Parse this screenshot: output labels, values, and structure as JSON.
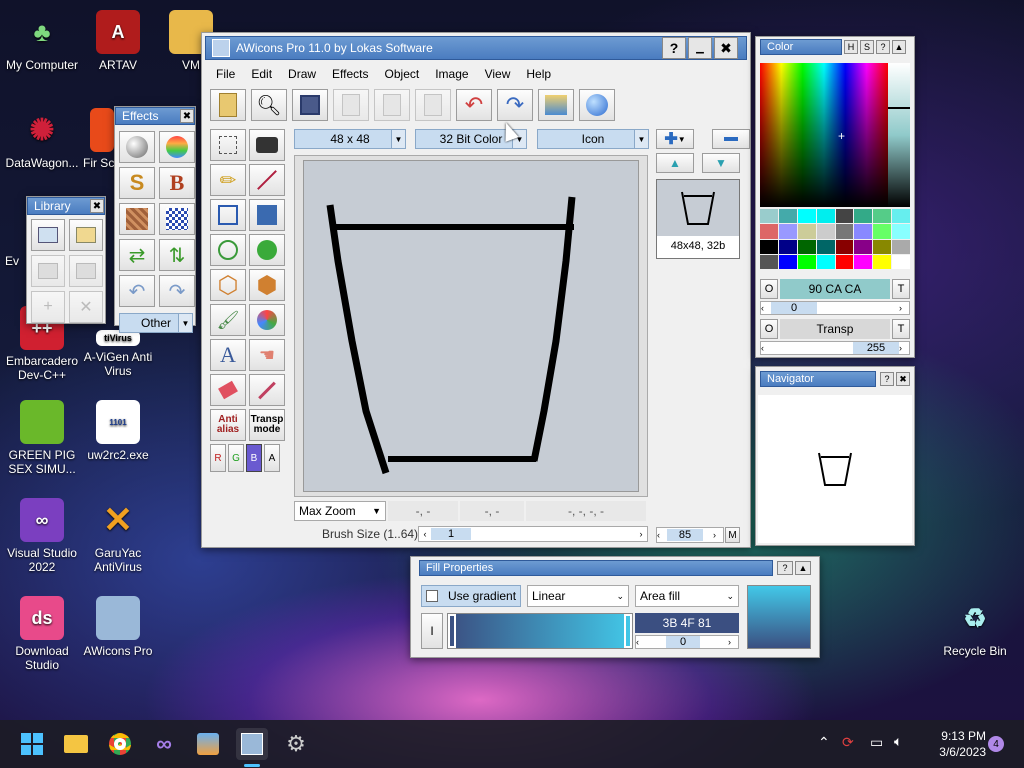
{
  "desktop": {
    "icons": [
      {
        "label": "My Computer"
      },
      {
        "label": "ARTAV"
      },
      {
        "label": "VM"
      },
      {
        "label": "DataWagon..."
      },
      {
        "label": "Fir Sca"
      },
      {
        "label": "Ev"
      },
      {
        "label": "Embarcadero Dev-C++"
      },
      {
        "label": "A-ViGen Anti Virus"
      },
      {
        "label": "GREEN PIG SEX SIMU..."
      },
      {
        "label": "uw2rc2.exe"
      },
      {
        "label": "Visual Studio 2022"
      },
      {
        "label": "GaruYac AntiVirus"
      },
      {
        "label": "Download Studio"
      },
      {
        "label": "AWicons Pro"
      },
      {
        "label": "Recycle Bin"
      }
    ],
    "antivirus_tag": "tiVirus"
  },
  "effects_panel": {
    "title": "Effects",
    "other_label": "Other"
  },
  "library_panel": {
    "title": "Library"
  },
  "main_window": {
    "title": "AWicons Pro 11.0 by Lokas Software",
    "menu": [
      "File",
      "Edit",
      "Draw",
      "Effects",
      "Object",
      "Image",
      "View",
      "Help"
    ],
    "size_select": "48 x 48",
    "color_select": "32 Bit Color",
    "type_select": "Icon",
    "tools_text": {
      "antialias": "Anti alias",
      "transp": "Transp mode",
      "r": "R",
      "g": "G",
      "b": "B",
      "a": "A"
    },
    "zoom_select": "Max Zoom",
    "coord1": "-, -",
    "coord2": "-, -",
    "coord3": "-, -, -, -",
    "brush_label": "Brush Size (1..64)",
    "brush_value": "1",
    "thumb_label": "48x48, 32b",
    "scroll_value": "85",
    "m_label": "M"
  },
  "color_panel": {
    "title": "Color",
    "color_value": "90 CA CA",
    "color_slider": "0",
    "transp_label": "Transp",
    "transp_value": "255",
    "o_label": "O",
    "t_label": "T"
  },
  "navigator": {
    "title": "Navigator"
  },
  "fill_panel": {
    "title": "Fill Properties",
    "use_gradient": "Use gradient",
    "gradient_type": "Linear",
    "fill_type": "Area fill",
    "i_label": "I",
    "color_value": "3B 4F 81",
    "slider_value": "0"
  },
  "taskbar": {
    "time": "9:13 PM",
    "date": "3/6/2023",
    "notif_count": "4"
  },
  "colors": {
    "title_blue": "#4a7cc0",
    "canvas_bg": "#c6ccd4",
    "picked_color": "#90caca",
    "fill_color": "#3b4f81"
  }
}
